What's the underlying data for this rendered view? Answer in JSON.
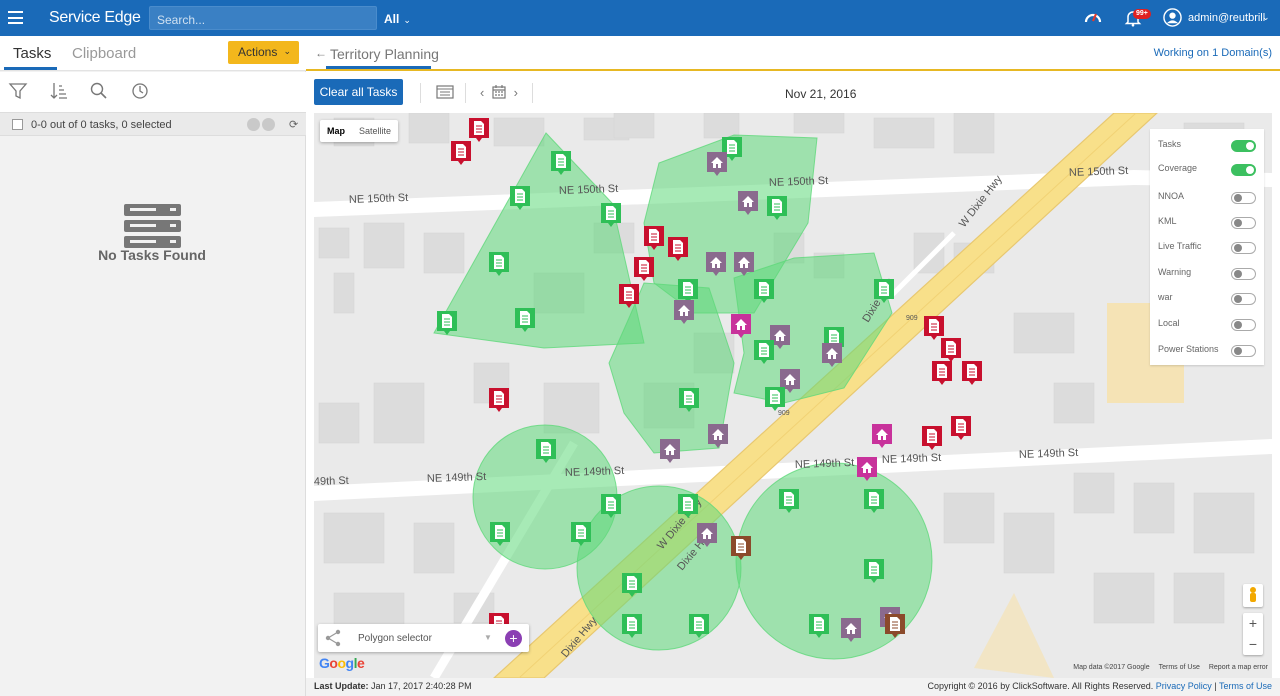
{
  "topbar": {
    "app_name": "Service Edge",
    "search_placeholder": "Search...",
    "scope_label": "All",
    "notification_badge": "99+",
    "user_name": "admin@reutbrill"
  },
  "left_panel": {
    "tabs": [
      {
        "label": "Tasks"
      },
      {
        "label": "Clipboard"
      }
    ],
    "actions_label": "Actions",
    "count_text": "0-0 out of 0 tasks, 0 selected",
    "empty_text": "No Tasks Found"
  },
  "right_panel": {
    "title": "Territory Planning",
    "domain_text": "Working on 1 Domain(s)",
    "clear_label": "Clear all Tasks",
    "date": "Nov 21, 2016"
  },
  "map": {
    "map_types": [
      "Map",
      "Satellite"
    ],
    "streets": [
      {
        "label": "NE 150th St"
      },
      {
        "label": "NE 150th St"
      },
      {
        "label": "NE 150th St"
      },
      {
        "label": "NE 150th St"
      },
      {
        "label": "NE 149th St"
      },
      {
        "label": "NE 149th St"
      },
      {
        "label": "NE 149th St"
      },
      {
        "label": "NE 149th St"
      },
      {
        "label": "NE 149th St"
      },
      {
        "label": "49th St"
      },
      {
        "label": "W Dixie Hwy"
      },
      {
        "label": "Dixie Hwy"
      },
      {
        "label": "W Dixie Hwy"
      },
      {
        "label": "Dixie Hwy"
      },
      {
        "label": "Dixie Hwy"
      },
      {
        "label": "909"
      },
      {
        "label": "909"
      }
    ],
    "layers": [
      {
        "label": "Tasks",
        "on": true
      },
      {
        "label": "Coverage",
        "on": true
      },
      {
        "label": "NNOA",
        "on": false
      },
      {
        "label": "KML",
        "on": false
      },
      {
        "label": "Live Traffic",
        "on": false
      },
      {
        "label": "Warning",
        "on": false
      },
      {
        "label": "war",
        "on": false
      },
      {
        "label": "Local",
        "on": false
      },
      {
        "label": "Power Stations",
        "on": false
      }
    ],
    "polygon_selector": "Polygon selector",
    "google_letters": [
      "G",
      "o",
      "o",
      "g",
      "l",
      "e"
    ],
    "attribution": [
      "Map data ©2017 Google",
      "Terms of Use",
      "Report a map error"
    ],
    "zoom_in": "+",
    "zoom_out": "−",
    "marker_colors": {
      "task_green": "#2fbf57",
      "task_red": "#c8102e",
      "task_brown": "#8b4a2b",
      "resource_grey": "#8a6a8e",
      "resource_magenta": "#c8329b"
    }
  },
  "footer": {
    "last_update_label": "Last Update:",
    "last_update_value": "Jan 17, 2017 2:40:28 PM",
    "copyright": "Copyright © 2016 by ClickSoftware. All Rights Reserved.",
    "privacy": "Privacy Policy",
    "separator": "|",
    "terms": "Terms of Use"
  },
  "colors": {
    "brand_blue": "#1a6ab8",
    "actions_yellow": "#f3b71c",
    "coverage_green": "#5fd87a"
  }
}
